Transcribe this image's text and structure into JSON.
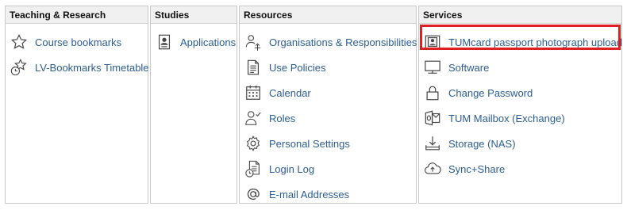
{
  "columns": [
    {
      "title": "Teaching & Research",
      "items": [
        {
          "label": "Course bookmarks",
          "icon": "star-icon"
        },
        {
          "label": "LV-Bookmarks Timetable",
          "icon": "star-clock-icon"
        }
      ]
    },
    {
      "title": "Studies",
      "items": [
        {
          "label": "Applications",
          "icon": "id-card-icon"
        }
      ]
    },
    {
      "title": "Resources",
      "items": [
        {
          "label": "Organisations & Responsibilities",
          "icon": "org-user-icon"
        },
        {
          "label": "Use Policies",
          "icon": "document-icon"
        },
        {
          "label": "Calendar",
          "icon": "calendar-icon"
        },
        {
          "label": "Roles",
          "icon": "user-check-icon"
        },
        {
          "label": "Personal Settings",
          "icon": "gear-icon"
        },
        {
          "label": "Login Log",
          "icon": "document-clock-icon"
        },
        {
          "label": "E-mail Addresses",
          "icon": "at-icon"
        }
      ]
    },
    {
      "title": "Services",
      "items": [
        {
          "label": "TUMcard passport photograph upload",
          "icon": "photo-id-icon"
        },
        {
          "label": "Software",
          "icon": "monitor-icon"
        },
        {
          "label": "Change Password",
          "icon": "lock-icon"
        },
        {
          "label": "TUM Mailbox (Exchange)",
          "icon": "exchange-icon"
        },
        {
          "label": "Storage (NAS)",
          "icon": "download-tray-icon"
        },
        {
          "label": "Sync+Share",
          "icon": "cloud-icon"
        }
      ]
    }
  ],
  "highlight_color": "#e01f25",
  "link_color": "#2b5d91"
}
